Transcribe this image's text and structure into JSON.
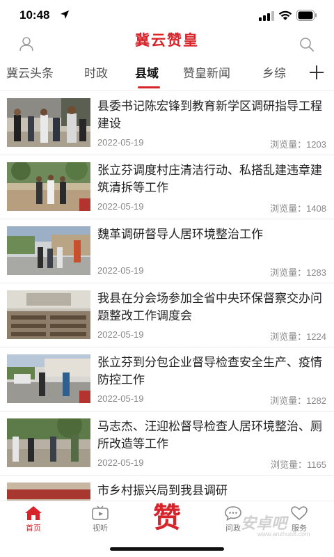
{
  "status_bar": {
    "time": "10:48"
  },
  "header": {
    "title": "冀云赞皇"
  },
  "tabs": [
    {
      "label": "冀云头条"
    },
    {
      "label": "时政"
    },
    {
      "label": "县域"
    },
    {
      "label": "赞皇新闻"
    },
    {
      "label": "乡综"
    }
  ],
  "active_tab": "县域",
  "news": [
    {
      "title": "县委书记陈宏锋到教育新学区调研指导工程建设",
      "date": "2022-05-19",
      "views": "浏览量：1203"
    },
    {
      "title": "张立芬调度村庄清洁行动、私搭乱建违章建筑清拆等工作",
      "date": "2022-05-19",
      "views": "浏览量：1408"
    },
    {
      "title": "魏革调研督导人居环境整治工作",
      "date": "2022-05-19",
      "views": "浏览量：1283"
    },
    {
      "title": "我县在分会场参加全省中央环保督察交办问题整改工作调度会",
      "date": "2022-05-19",
      "views": "浏览量：1224"
    },
    {
      "title": "张立芬到分包企业督导检查安全生产、疫情防控工作",
      "date": "2022-05-19",
      "views": "浏览量：1282"
    },
    {
      "title": "马志杰、汪迎松督导检查人居环境整治、厕所改造等工作",
      "date": "2022-05-19",
      "views": "浏览量：1165"
    },
    {
      "title": "市乡村振兴局到我县调研",
      "date": "",
      "views": ""
    }
  ],
  "bottom_nav": {
    "home": "首页",
    "video": "视听",
    "center_logo": "赞",
    "ask": "问政",
    "service": "服务"
  },
  "watermark": {
    "main": "安卓吧",
    "sub": "www.anzhuo8.com"
  },
  "colors": {
    "accent": "#d7242a",
    "text": "#222222",
    "muted": "#888888"
  }
}
